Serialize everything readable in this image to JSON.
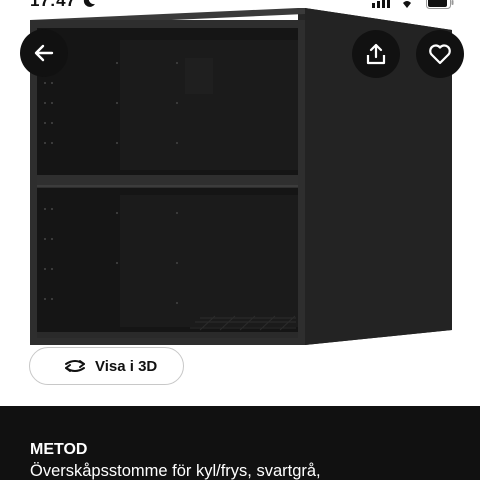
{
  "status_bar": {
    "time": "17:47",
    "icons": [
      "moon-icon",
      "signal-icon",
      "wifi-icon",
      "battery-icon"
    ]
  },
  "product_image": {
    "description_icon": "product-photo",
    "colors": {
      "cabinet": "#2b2b2b",
      "cabinet_side": "#242424",
      "interior": "#141414"
    }
  },
  "nav": {
    "back_icon": "arrow-left-icon",
    "share_icon": "share-icon",
    "favorite_icon": "heart-icon"
  },
  "view_3d": {
    "label": "Visa i 3D",
    "icon": "rotate-3d-icon"
  },
  "product": {
    "name": "METOD",
    "description": "Överskåpsstomme för kyl/frys, svartgrå,"
  },
  "colors": {
    "nav_button_bg": "#111111",
    "info_panel_bg": "#111111",
    "info_text": "#ffffff"
  }
}
